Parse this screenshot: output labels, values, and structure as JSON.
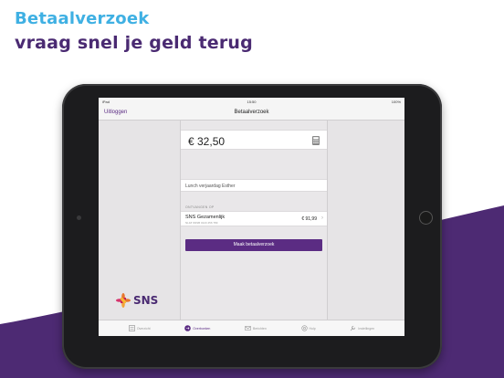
{
  "headline": {
    "line1": "Betaalverzoek",
    "line2": "vraag snel je geld terug"
  },
  "status_bar": {
    "carrier": "iPad",
    "time": "15:50",
    "battery": "100%"
  },
  "nav_bar": {
    "logout_label": "Uitloggen",
    "title": "Betaalverzoek"
  },
  "request": {
    "amount": "€  32,50",
    "description": "Lunch verjaardag Esther",
    "section_label": "ONTVANGEN OP",
    "account": {
      "name": "SNS Gezamenlijk",
      "iban": "NL18 SNSB 0123 456 789",
      "balance": "€ 91,99"
    },
    "button_label": "Maak betaalverzoek"
  },
  "logo": {
    "text": "SNS"
  },
  "tabs": [
    {
      "label": "Overzicht",
      "icon": "overview-icon",
      "active": false
    },
    {
      "label": "Overboeken",
      "icon": "transfer-icon",
      "active": true
    },
    {
      "label": "Berichten",
      "icon": "mail-icon",
      "active": false
    },
    {
      "label": "Hulp",
      "icon": "help-icon",
      "active": false
    },
    {
      "label": "Instellingen",
      "icon": "wrench-icon",
      "active": false
    }
  ],
  "colors": {
    "brand_purple": "#5b2c83",
    "headline_blue": "#3fb0e3",
    "background_purple": "#4d2a73"
  }
}
